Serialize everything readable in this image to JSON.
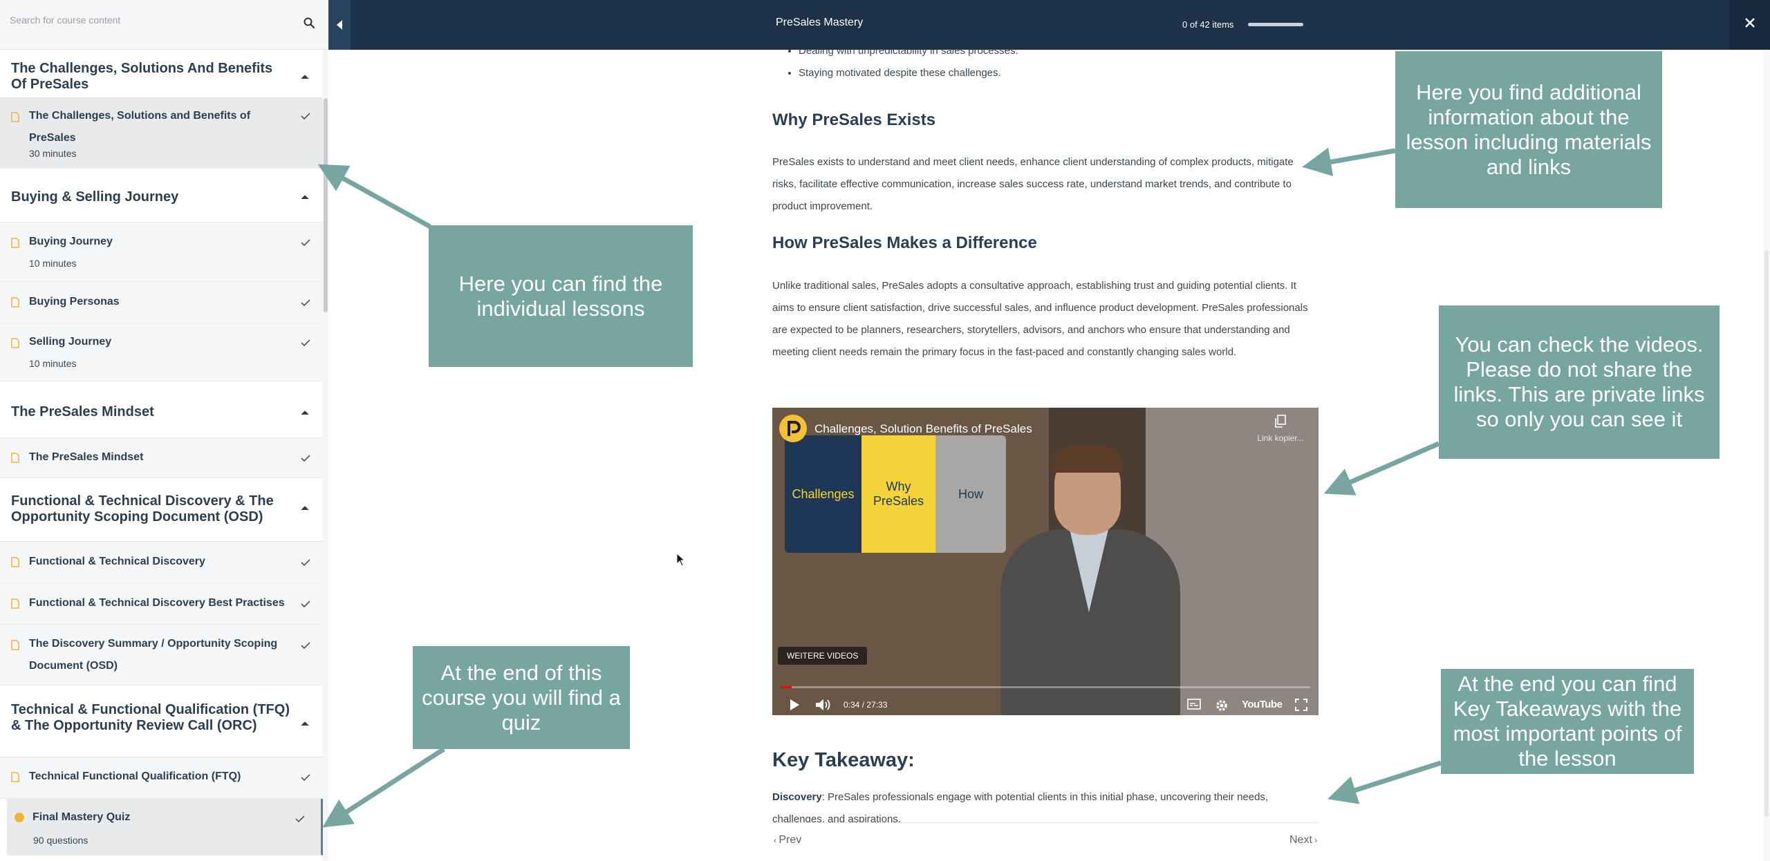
{
  "search": {
    "placeholder": "Search for course content"
  },
  "topbar": {
    "course_title": "PreSales Mastery",
    "progress_text": "0 of 42 items",
    "progress_fraction": 0.0
  },
  "sidebar": {
    "sections": [
      {
        "title": "The Challenges, Solutions And Benefits Of PreSales",
        "lessons": [
          {
            "title": "The Challenges, Solutions and Benefits of PreSales",
            "sub": "30 minutes"
          }
        ]
      },
      {
        "title": "Buying & Selling Journey",
        "lessons": [
          {
            "title": "Buying Journey",
            "sub": "10 minutes"
          },
          {
            "title": "Buying Personas",
            "sub": ""
          },
          {
            "title": "Selling Journey",
            "sub": "10 minutes"
          }
        ]
      },
      {
        "title": "The PreSales Mindset",
        "lessons": [
          {
            "title": "The PreSales Mindset",
            "sub": ""
          }
        ]
      },
      {
        "title": "Functional & Technical Discovery & The Opportunity Scoping Document (OSD)",
        "lessons": [
          {
            "title": "Functional & Technical Discovery",
            "sub": ""
          },
          {
            "title": "Functional & Technical Discovery Best Practises",
            "sub": ""
          },
          {
            "title": "The Discovery Summary / Opportunity Scoping Document (OSD)",
            "sub": ""
          }
        ]
      },
      {
        "title": "Technical & Functional Qualification (TFQ) & The Opportunity Review Call (ORC)",
        "lessons": [
          {
            "title": "Technical Functional Qualification (FTQ)",
            "sub": ""
          },
          {
            "title": "Final Mastery Quiz",
            "sub": "90 questions"
          }
        ]
      }
    ]
  },
  "content": {
    "bullets": [
      "Dealing with unpredictability in sales processes.",
      "Staying motivated despite these challenges."
    ],
    "h_why": "Why PreSales Exists",
    "p_why": "PreSales exists to understand and meet client needs, enhance client understanding of complex products, mitigate risks, facilitate effective communication, increase sales success rate, understand market trends, and contribute to product improvement.",
    "h_how": "How PreSales Makes a Difference",
    "p_how": "Unlike traditional sales, PreSales adopts a consultative approach, establishing trust and guiding potential clients. It aims to ensure client satisfaction, drive successful sales, and influence product development. PreSales professionals are expected to be planners, researchers, storytellers, advisors, and anchors who ensure that understanding and meeting client needs remain the primary focus in the fast-paced and constantly changing sales world.",
    "key_takeaway": "Key Takeaway:",
    "takeaway_term": "Discovery",
    "takeaway_text": ": PreSales professionals engage with potential clients in this initial phase, uncovering their needs, challenges, and aspirations.",
    "prev": "Prev",
    "next": "Next"
  },
  "video": {
    "title": "Challenges, Solution Benefits of PreSales",
    "copy_link": "Link kopier...",
    "more_videos": "WEITERE VIDEOS",
    "time": "0:34 / 27:33",
    "played_fraction": 0.021,
    "youtube": "YouTube",
    "slide": {
      "challenges": "Challenges",
      "why": "Why PreSales",
      "how": "How"
    }
  },
  "callouts": {
    "lessons": "Here you can find the individual lessons",
    "info": "Here you find additional information about the lesson including materials and links",
    "videos": "You can check the videos. Please do not share the links. This are private links so only you can see it",
    "quiz": "At the end of this course you will find a quiz",
    "takeaways": "At the end you can find Key Takeaways with the most important points of the lesson"
  },
  "colors": {
    "topbar": "#1d3149",
    "callout": "#77a6a0",
    "doc_icon": "#f0b43c",
    "slide_navy": "#1f3756",
    "slide_yellow": "#f5d33b"
  }
}
